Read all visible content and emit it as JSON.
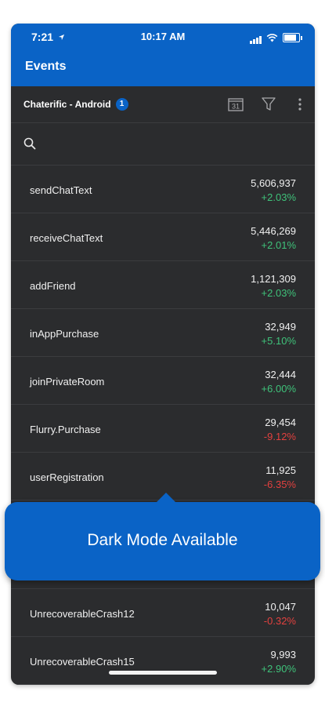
{
  "status_bar": {
    "time_left": "7:21",
    "time_center": "10:17 AM"
  },
  "header": {
    "title": "Events"
  },
  "app_bar": {
    "app_name": "Chaterific - Android",
    "badge_count": "1",
    "calendar_day": "31"
  },
  "events_top": [
    {
      "name": "sendChatText",
      "value": "5,606,937",
      "change": "+2.03%",
      "direction": "positive"
    },
    {
      "name": "receiveChatText",
      "value": "5,446,269",
      "change": "+2.01%",
      "direction": "positive"
    },
    {
      "name": "addFriend",
      "value": "1,121,309",
      "change": "+2.03%",
      "direction": "positive"
    },
    {
      "name": "inAppPurchase",
      "value": "32,949",
      "change": "+5.10%",
      "direction": "positive"
    },
    {
      "name": "joinPrivateRoom",
      "value": "32,444",
      "change": "+6.00%",
      "direction": "positive"
    },
    {
      "name": "Flurry.Purchase",
      "value": "29,454",
      "change": "-9.12%",
      "direction": "negative"
    },
    {
      "name": "userRegistration",
      "value": "11,925",
      "change": "-6.35%",
      "direction": "negative"
    }
  ],
  "events_bottom": [
    {
      "name": "UnrecoverableCrash12",
      "value": "10,047",
      "change": "-0.32%",
      "direction": "negative"
    },
    {
      "name": "UnrecoverableCrash15",
      "value": "9,993",
      "change": "+2.90%",
      "direction": "positive"
    }
  ],
  "callout": {
    "text": "Dark Mode Available"
  },
  "colors": {
    "accent": "#0a63c6",
    "background": "#2b2c2e",
    "positive": "#3fc27a",
    "negative": "#e2413f"
  }
}
